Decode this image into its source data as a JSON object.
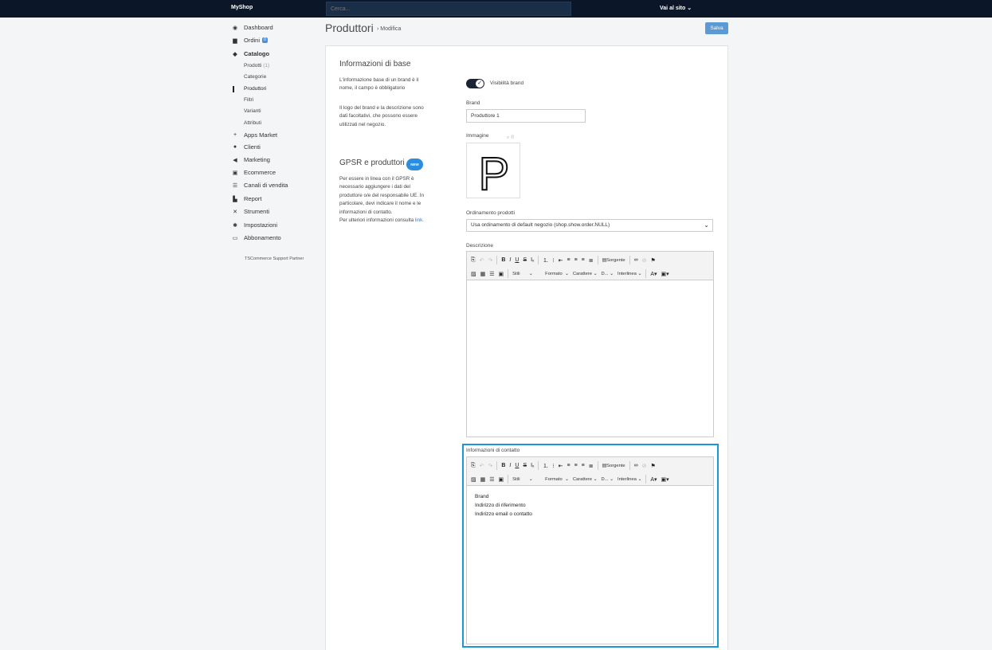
{
  "topbar": {
    "brand": "MyShop",
    "search_placeholder": "Cerca...",
    "visit_site": "Vai al sito"
  },
  "sidebar": {
    "items": [
      {
        "label": "Dashboard",
        "icon": "dashboard-icon"
      },
      {
        "label": "Ordini",
        "icon": "file-icon",
        "badge": "0"
      },
      {
        "label": "Catalogo",
        "icon": "tag-icon"
      },
      {
        "label": "Apps Market",
        "icon": "plus-icon"
      },
      {
        "label": "Clienti",
        "icon": "user-icon"
      },
      {
        "label": "Marketing",
        "icon": "megaphone-icon"
      },
      {
        "label": "Ecommerce",
        "icon": "basket-icon"
      },
      {
        "label": "Canali di vendita",
        "icon": "list-icon"
      },
      {
        "label": "Report",
        "icon": "chart-icon"
      },
      {
        "label": "Strumenti",
        "icon": "tools-icon"
      },
      {
        "label": "Impostazioni",
        "icon": "gear-icon"
      },
      {
        "label": "Abbonamento",
        "icon": "card-icon"
      }
    ],
    "catalog_sub": [
      {
        "label": "Prodotti",
        "count": "(1)"
      },
      {
        "label": "Categorie"
      },
      {
        "label": "Produttori"
      },
      {
        "label": "Filtri"
      },
      {
        "label": "Varianti"
      },
      {
        "label": "Attributi"
      }
    ],
    "partner": "TSCommerce Support Partner"
  },
  "header": {
    "title": "Produttori",
    "breadcrumb": "Modifica",
    "save": "Salva"
  },
  "info": {
    "title": "Informazioni di base",
    "p1": "L'informazione base di un brand è il nome, il campo è obbligatorio",
    "p2": "Il logo del brand e la descrizione sono dati facoltativi, che possono essere utilizzati nel negozio.",
    "gpsr_title": "GPSR e produttori",
    "new_badge": "NEW",
    "gpsr_text": "Per essere in linea con il GPSR è necessario aggiungere i dati del produttore o/e del responsabile UE. In particolare, devi indicare il nome e le informazioni di contatto.",
    "gpsr_more": "Per ulteriori informazioni consulta",
    "gpsr_link": "link."
  },
  "form": {
    "visibility_label": "Visibilità brand",
    "visibility_on": true,
    "brand_label": "Brand",
    "brand_value": "Produttore 1",
    "image_label": "Immagine",
    "image_letter": "P",
    "order_label": "Ordinamento prodotti",
    "order_value": "Usa ordinamento di default negozio (shop.show.order.NULL)",
    "description_label": "Descrizione",
    "contact_label": "Informazioni di contatto",
    "contact_lines": [
      "Brand",
      "Indirizzo di riferimento",
      "Indirizzo email o contatto"
    ]
  },
  "editor_toolbar": {
    "source": "Sorgente",
    "styles": "Stili",
    "format": "Formato",
    "font": "Carattere",
    "size": "D...",
    "line_height": "Interlinea"
  }
}
